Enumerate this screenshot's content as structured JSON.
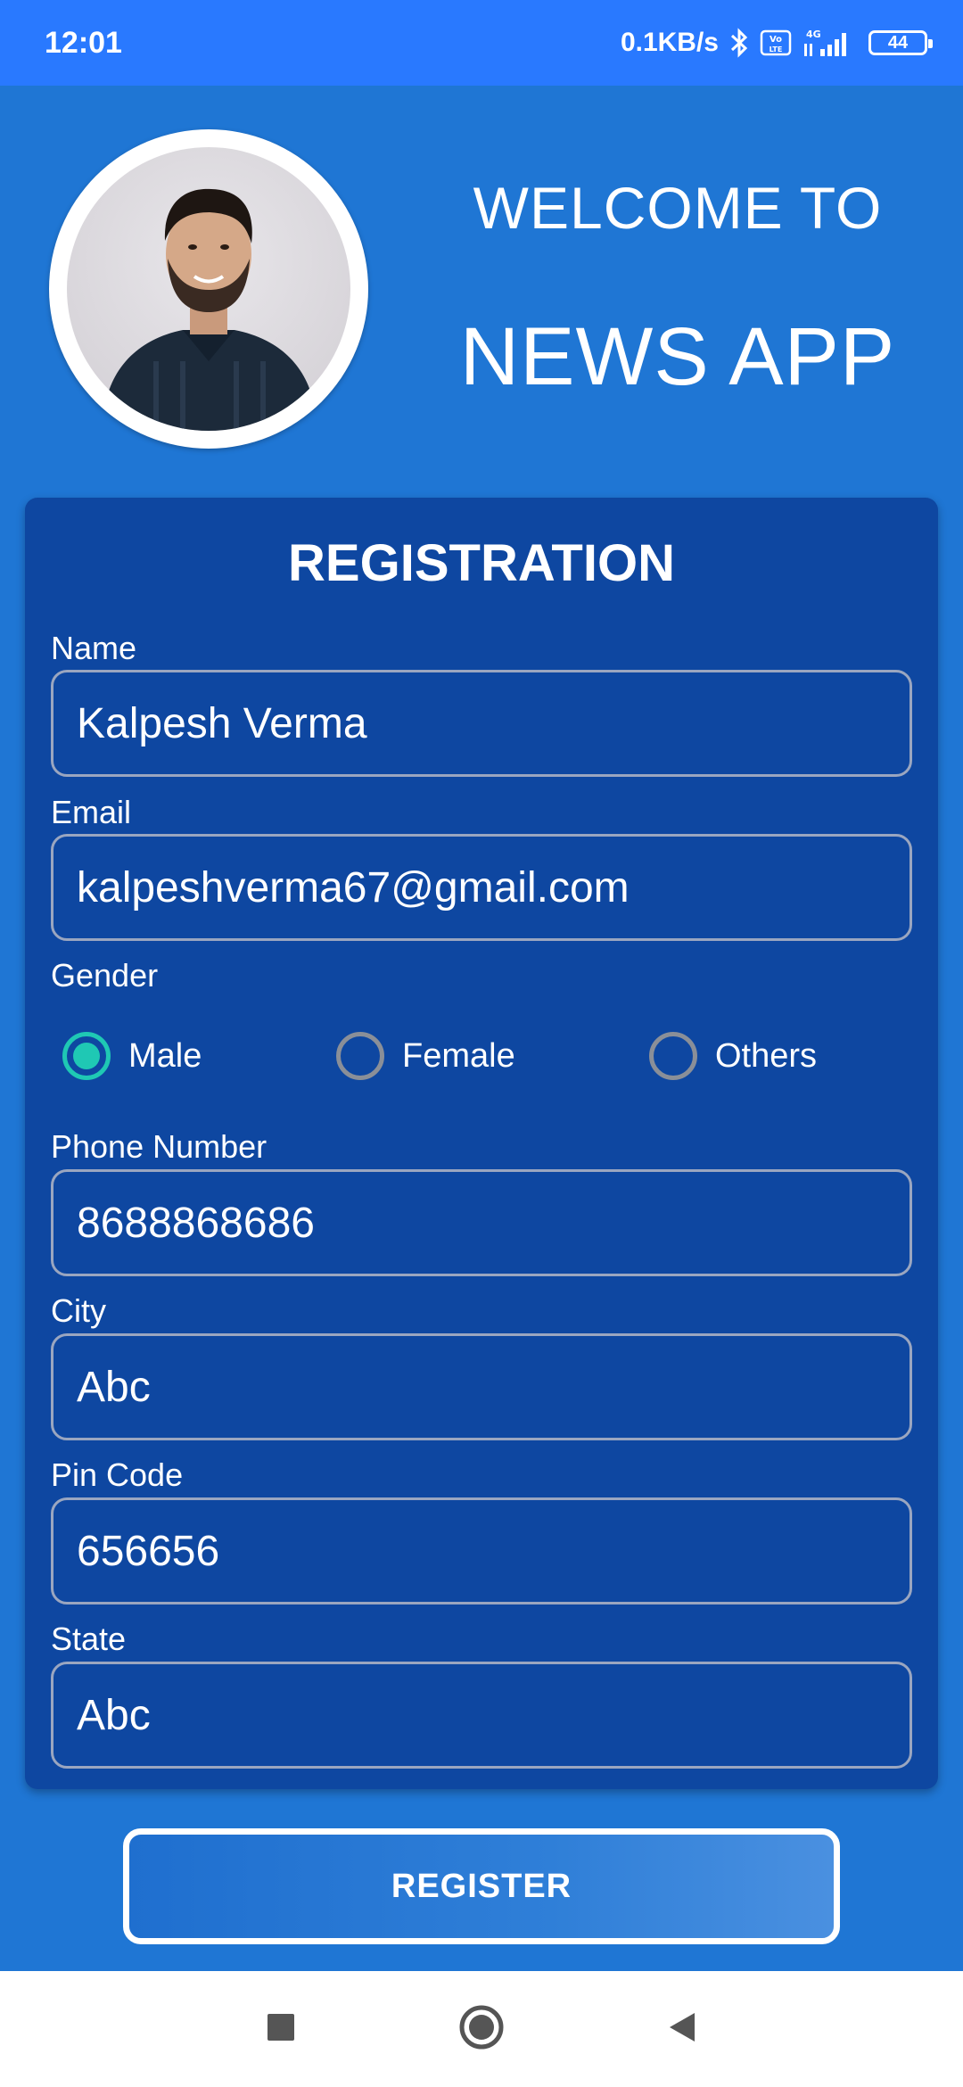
{
  "status_bar": {
    "time": "12:01",
    "network_speed": "0.1KB/s",
    "bluetooth_icon": "bluetooth-icon",
    "volte_icon": "volte-icon",
    "signal_label": "4G",
    "battery_level": "44"
  },
  "header": {
    "welcome_text": "WELCOME TO",
    "app_name": "NEWS APP",
    "avatar_icon": "profile-photo"
  },
  "form": {
    "title": "REGISTRATION",
    "name_label": "Name",
    "name_value": "Kalpesh Verma",
    "email_label": "Email",
    "email_value": "kalpeshverma67@gmail.com",
    "gender_label": "Gender",
    "gender_options": [
      "Male",
      "Female",
      "Others"
    ],
    "gender_selected": "Male",
    "phone_label": "Phone Number",
    "phone_value": "8688868686",
    "city_label": "City",
    "city_value": "Abc",
    "pincode_label": "Pin Code",
    "pincode_value": "656656",
    "state_label": "State",
    "state_value": "Abc",
    "submit_label": "REGISTER"
  },
  "colors": {
    "background": "#1f76d4",
    "status_bar": "#2979ff",
    "card": "#0e47a1",
    "radio_accent": "#1fc8b4"
  },
  "nav_bar": {
    "recent_icon": "square-icon",
    "home_icon": "circle-icon",
    "back_icon": "back-triangle-icon"
  }
}
